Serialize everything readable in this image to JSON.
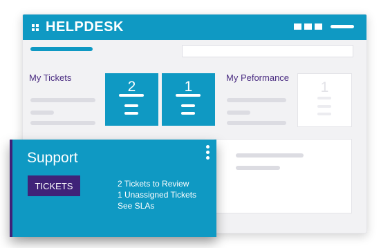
{
  "app": {
    "title": "HELPDESK"
  },
  "my_tickets": {
    "label": "My Tickets",
    "tiles": [
      {
        "value": "2"
      },
      {
        "value": "1"
      }
    ]
  },
  "my_performance": {
    "label": "My Peformance",
    "tile": {
      "value": "1"
    }
  },
  "support_card": {
    "title": "Support",
    "button_label": "TICKETS",
    "links": [
      "2 Tickets to Review",
      "1 Unassigned Tickets",
      "See SLAs"
    ]
  },
  "colors": {
    "primary": "#0f99c3",
    "accent": "#3f2278",
    "label_text": "#4b2d82"
  },
  "icons": [
    "grid-icon",
    "window-control-icon",
    "kebab-menu-icon"
  ]
}
